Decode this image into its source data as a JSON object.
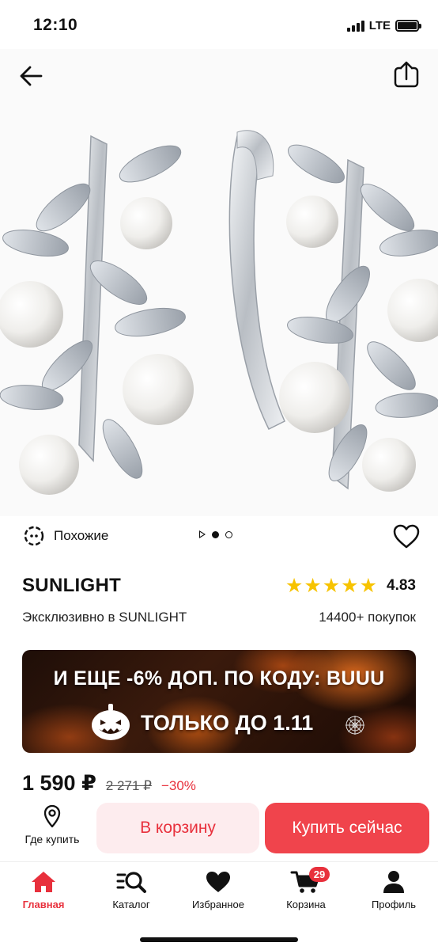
{
  "status_bar": {
    "time": "12:10",
    "network": "LTE"
  },
  "header": {
    "back_icon": "arrow-left-icon",
    "share_icon": "share-icon"
  },
  "gallery": {
    "similar_label": "Похожие",
    "slides_total": 2,
    "active_slide": 1
  },
  "product": {
    "brand": "SUNLIGHT",
    "rating": "4.83",
    "stars": 5,
    "exclusive": "Эксклюзивно в SUNLIGHT",
    "purchases": "14400+ покупок"
  },
  "promo": {
    "line1": "И ЕЩЕ  -6% ДОП. ПО КОДУ:  BUUU",
    "line2": "ТОЛЬКО ДО 1.11"
  },
  "price": {
    "current": "1 590 ₽",
    "old": "2 271 ₽",
    "discount": "−30%"
  },
  "actions": {
    "where_buy": "Где купить",
    "add_to_cart": "В корзину",
    "buy_now": "Купить сейчас"
  },
  "nav": {
    "items": [
      {
        "label": "Главная",
        "icon": "home-icon",
        "active": true
      },
      {
        "label": "Каталог",
        "icon": "catalog-search-icon"
      },
      {
        "label": "Избранное",
        "icon": "heart-icon"
      },
      {
        "label": "Корзина",
        "icon": "cart-icon",
        "badge": "29"
      },
      {
        "label": "Профиль",
        "icon": "profile-icon"
      }
    ]
  },
  "colors": {
    "accent": "#e8303c",
    "buy_button": "#f0444c",
    "cart_button_bg": "#fdecee",
    "star": "#f7c300"
  }
}
